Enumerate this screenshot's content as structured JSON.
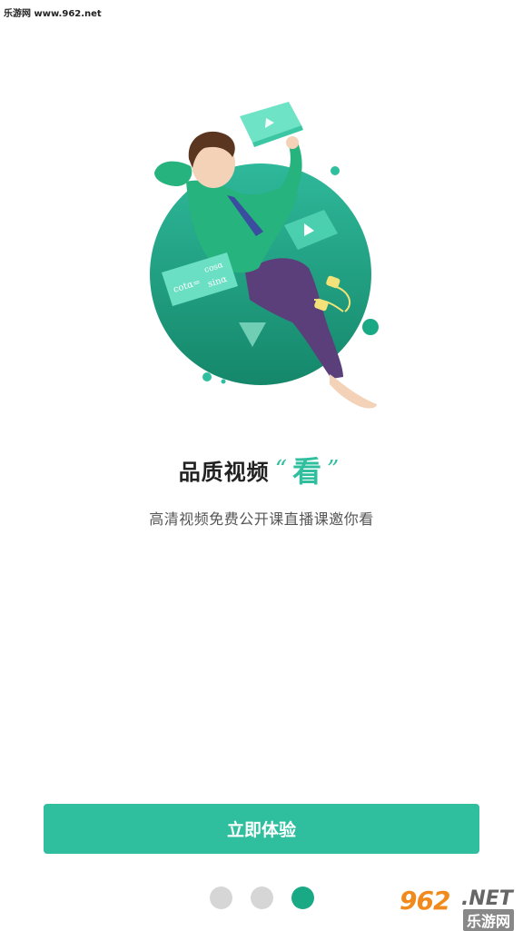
{
  "watermark": {
    "top_text": "乐游网 www.962.net",
    "logo_number": "962",
    "logo_net": ".NET",
    "logo_cn": "乐游网"
  },
  "illustration": {
    "formula_top": "cosα",
    "formula_left": "cotα=",
    "formula_bottom": "sinα"
  },
  "headline": {
    "main": "品质视频",
    "open_quote": "“",
    "accent": "看",
    "close_quote": "”"
  },
  "subtitle": "高清视频免费公开课直播课邀你看",
  "cta": {
    "label": "立即体验"
  },
  "pager": {
    "total": 3,
    "active_index": 2
  },
  "colors": {
    "accent": "#2fbf9f",
    "dot_active": "#1aa985",
    "dot_inactive": "#d6d6d6"
  }
}
